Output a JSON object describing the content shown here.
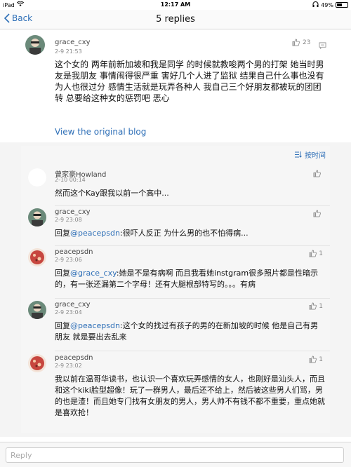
{
  "status_bar": {
    "device": "iPad",
    "time": "12:17 AM",
    "battery": "49%",
    "battery_level": 0.49
  },
  "nav": {
    "back_label": "Back",
    "title": "5 replies"
  },
  "post": {
    "username": "grace_cxy",
    "timestamp": "2-9 21:53",
    "likes": "23",
    "text": "这个女的 两年前新加坡和我是同学 的时候就教唆两个男的打架 她当时男友是我朋友 事情闹得很严重 害好几个人进了监狱 结果自己什么事也没有 为人也很过分 感情生活就是玩弄各种人 我自己三个好朋友都被玩的团团转 总要给这种女的惩罚吧 恶心",
    "view_blog": "View the original blog"
  },
  "sort": {
    "label": "按时间"
  },
  "replies": [
    {
      "username": "曾家豪Howland",
      "timestamp": "2-10 00:14",
      "likes": "",
      "prefix": "",
      "mention": "",
      "text": "然而这个Kay跟我以前一个高中..."
    },
    {
      "username": "grace_cxy",
      "timestamp": "2-9 23:08",
      "likes": "",
      "prefix": "回复",
      "mention": "@peacepsdn",
      "text": ":很吓人反正 为什么男的也不怕得病..."
    },
    {
      "username": "peacepsdn",
      "timestamp": "2-9 23:06",
      "likes": "1",
      "prefix": "回复",
      "mention": "@grace_cxy",
      "text": ":她是不是有病啊 而且我看她instgram很多照片都是性暗示的，有一张还漏第二个字母！还有大腿根部特写的。。。有病"
    },
    {
      "username": "grace_cxy",
      "timestamp": "2-9 23:04",
      "likes": "1",
      "prefix": "回复",
      "mention": "@peacepsdn",
      "text": ":这个女的找过有孩子的男的在新加坡的时候 他是自己有男朋友 就是要出去乱来"
    },
    {
      "username": "peacepsdn",
      "timestamp": "2-9 23:02",
      "likes": "1",
      "prefix": "",
      "mention": "",
      "text": "我以前在温哥华读书，也认识一个喜欢玩弄感情的女人，也刚好是汕头人，而且和这个kiki脸型超像！玩了一群男人，最后还不给上，然后被这些男人们骂，男的也是渣！而且她专门找有女朋友的男人，男人帅不有钱不都不重要，重点她就是喜欢抢！"
    }
  ],
  "reply_box": {
    "placeholder": "Reply"
  },
  "colors": {
    "link": "#2e6fb7",
    "background": "#f4f4f4"
  }
}
